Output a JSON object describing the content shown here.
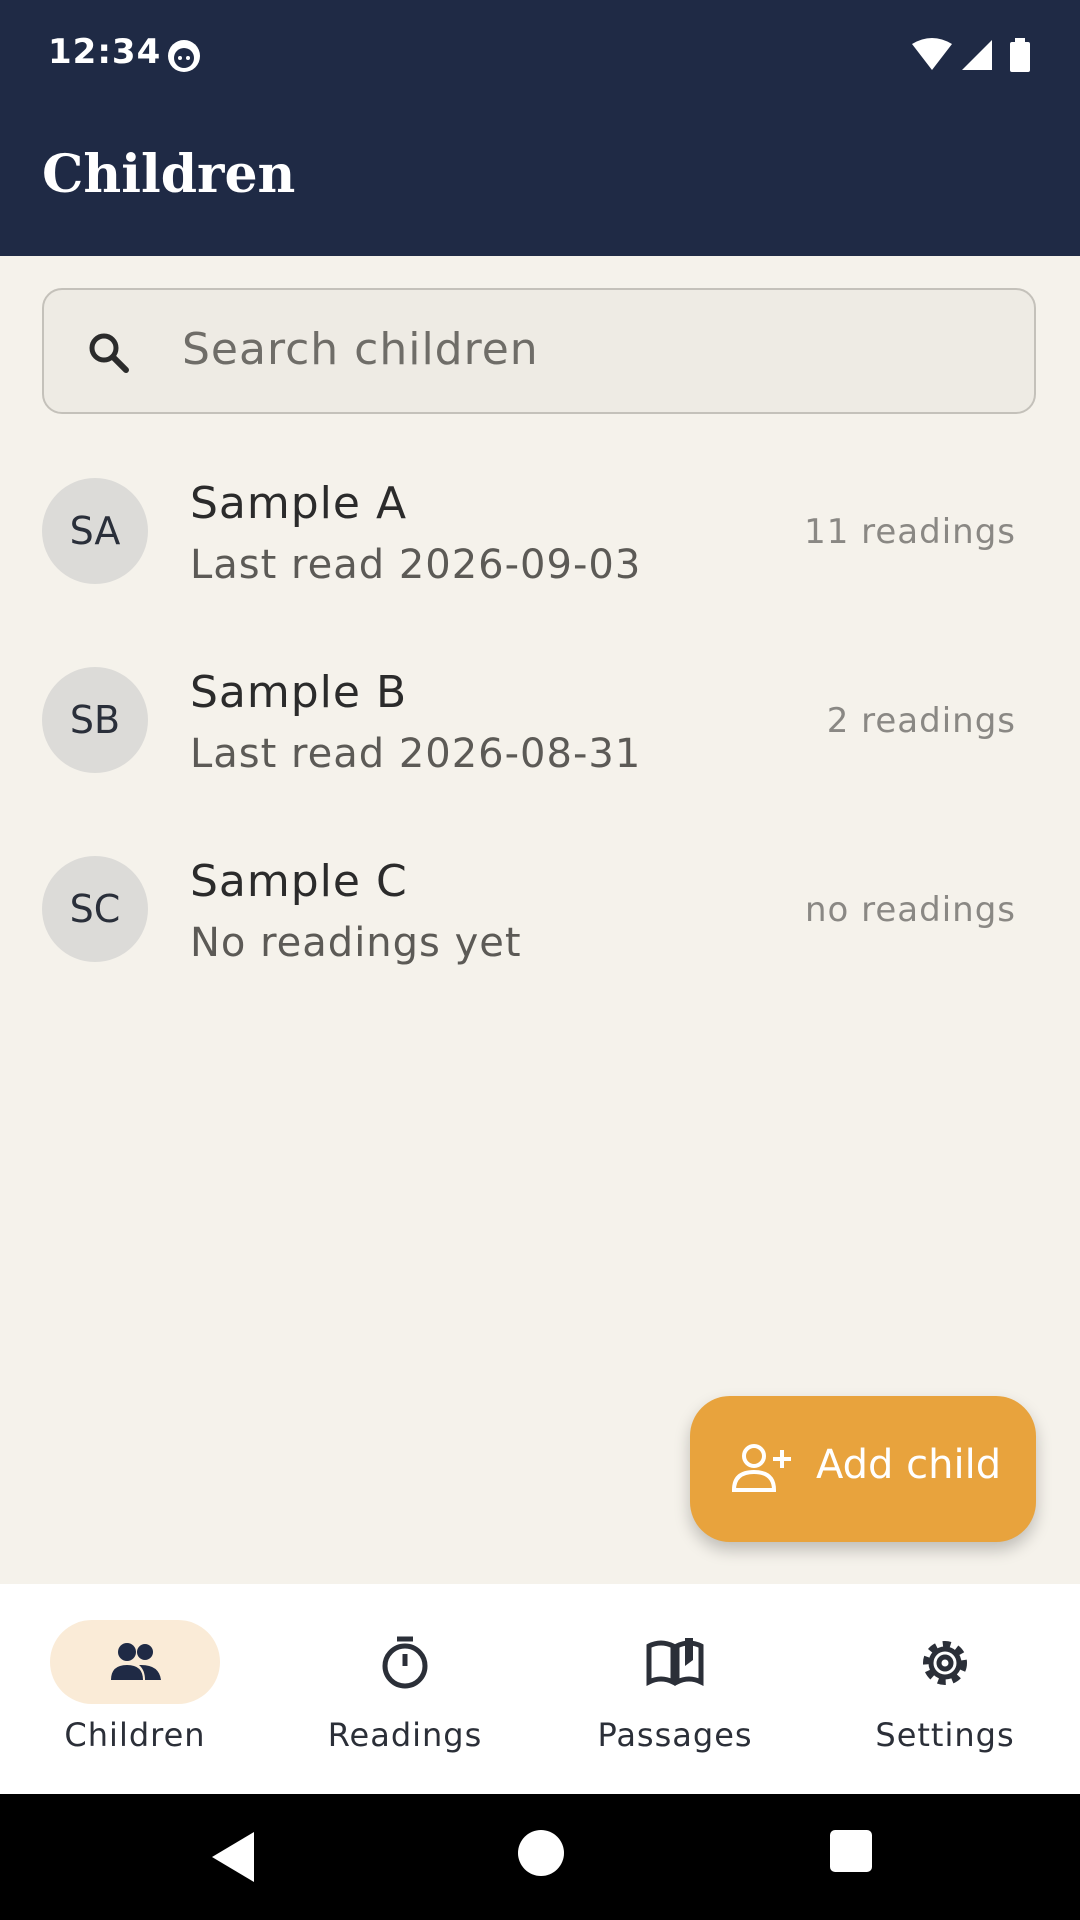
{
  "status_bar": {
    "time": "12:34"
  },
  "app_bar": {
    "title": "Children"
  },
  "search": {
    "placeholder": "Search children"
  },
  "children": [
    {
      "initials": "SA",
      "name": "Sample A",
      "subtitle": "Last read 2026-09-03",
      "count": "11 readings"
    },
    {
      "initials": "SB",
      "name": "Sample B",
      "subtitle": "Last read 2026-08-31",
      "count": "2 readings"
    },
    {
      "initials": "SC",
      "name": "Sample C",
      "subtitle": "No readings yet",
      "count": "no readings"
    }
  ],
  "fab": {
    "label": "Add child",
    "icon": "person-add-icon"
  },
  "bottom_nav": {
    "items": [
      {
        "label": "Children",
        "icon": "people-icon",
        "selected": true
      },
      {
        "label": "Readings",
        "icon": "timer-icon",
        "selected": false
      },
      {
        "label": "Passages",
        "icon": "book-icon",
        "selected": false
      },
      {
        "label": "Settings",
        "icon": "gear-icon",
        "selected": false
      }
    ]
  },
  "colors": {
    "header": "#1f2a45",
    "background": "#f5f2eb",
    "accent": "#e8a33d",
    "nav_selected": "#faebd7"
  }
}
